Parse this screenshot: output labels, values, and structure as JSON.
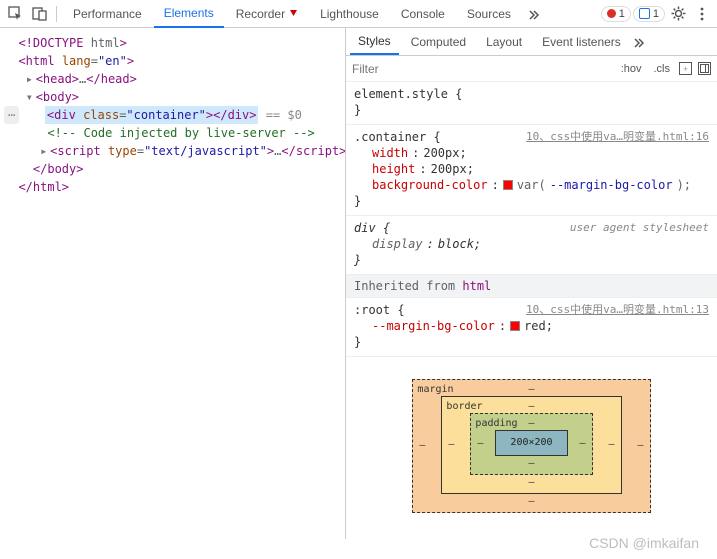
{
  "tabs": {
    "items": [
      "Performance",
      "Elements",
      "Recorder",
      "Lighthouse",
      "Console",
      "Sources"
    ],
    "active_index": 1,
    "error_count": "1",
    "msg_count": "1"
  },
  "dom_tree": {
    "doctype": "<!DOCTYPE html>",
    "html_open": "<html lang=\"en\">",
    "head": "<head>…</head>",
    "body_open": "<body>",
    "selected_div": "<div class=\"container\"></div>",
    "eq0": " == $0",
    "comment": "<!-- Code injected by live-server -->",
    "script": "<script type=\"text/javascript\">…</script>",
    "body_close": "</body>",
    "html_close": "</html>"
  },
  "subtabs": {
    "items": [
      "Styles",
      "Computed",
      "Layout",
      "Event listeners"
    ],
    "active_index": 0
  },
  "filter": {
    "placeholder": "Filter",
    "hov": ":hov",
    "cls": ".cls"
  },
  "styles": {
    "element_style": {
      "selector": "element.style",
      "open": " {",
      "close": "}"
    },
    "container": {
      "selector": ".container",
      "open": " {",
      "src": "10、css中使用va…明变量.html:16",
      "props": [
        {
          "k": "width",
          "v": "200px;"
        },
        {
          "k": "height",
          "v": "200px;"
        },
        {
          "k": "background-color",
          "v_prefix": "var(",
          "varname": "--margin-bg-color",
          "v_suffix": ");",
          "swatch": true
        }
      ],
      "close": "}"
    },
    "div_ua": {
      "selector": "div",
      "open": " {",
      "src": "user agent stylesheet",
      "props": [
        {
          "k": "display",
          "v": "block;"
        }
      ],
      "close": "}"
    },
    "inherit_label": "Inherited from ",
    "inherit_tag": "html",
    "root": {
      "selector": ":root",
      "open": " {",
      "src": "10、css中使用va…明变量.html:13",
      "props": [
        {
          "k": "--margin-bg-color",
          "v": "red;",
          "swatch": true
        }
      ],
      "close": "}"
    }
  },
  "boxmodel": {
    "margin_label": "margin",
    "border_label": "border",
    "padding_label": "padding",
    "content": "200×200",
    "dash": "–"
  },
  "watermark": "CSDN @imkaifan"
}
